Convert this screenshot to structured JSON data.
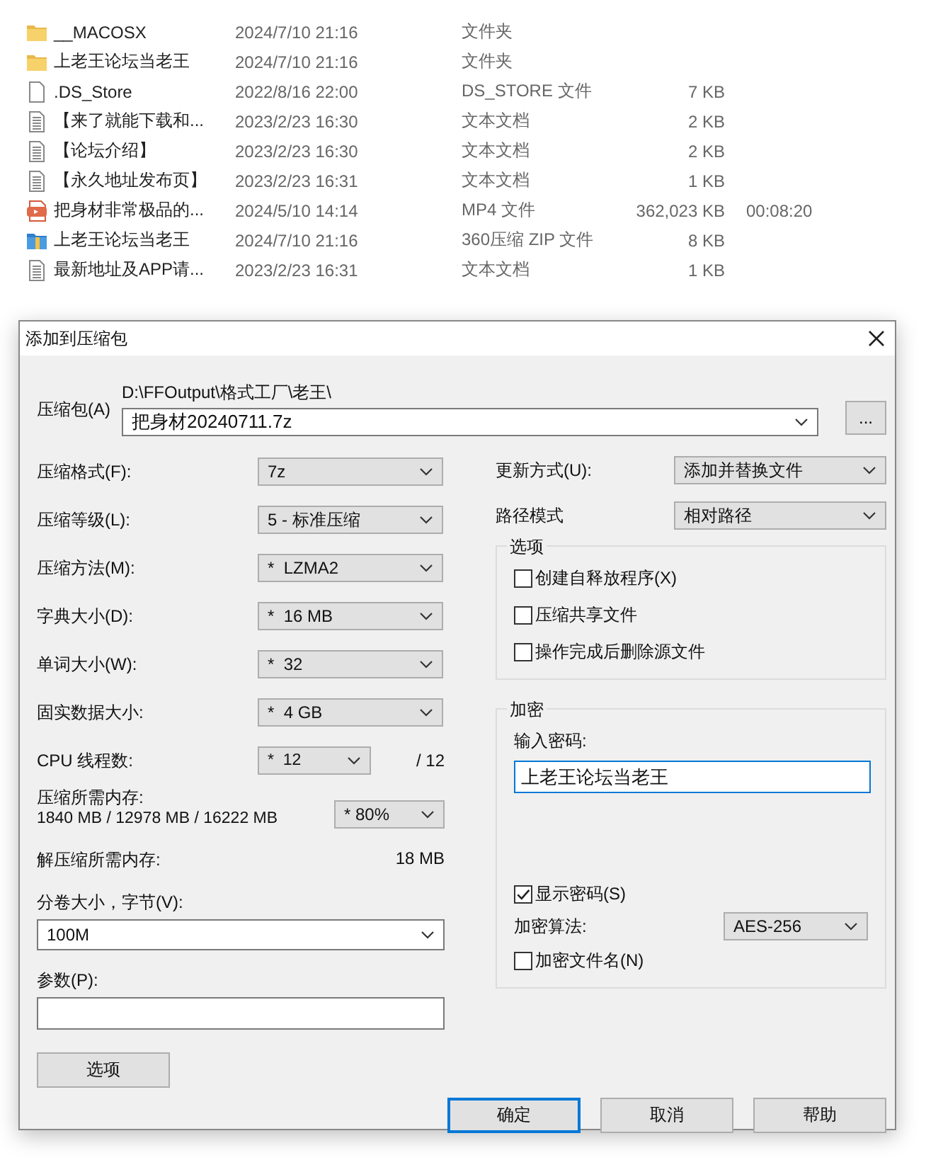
{
  "files": [
    {
      "kind": "folder",
      "name": "__MACOSX",
      "date": "2024/7/10 21:16",
      "type": "文件夹"
    },
    {
      "kind": "folder",
      "name": "上老王论坛当老王",
      "date": "2024/7/10 21:16",
      "type": "文件夹"
    },
    {
      "kind": "file",
      "name": ".DS_Store",
      "date": "2022/8/16 22:00",
      "type": "DS_STORE 文件",
      "size": "7 KB"
    },
    {
      "kind": "text",
      "name": "【来了就能下载和...",
      "date": "2023/2/23 16:30",
      "type": "文本文档",
      "size": "2 KB"
    },
    {
      "kind": "text",
      "name": "【论坛介绍】",
      "date": "2023/2/23 16:30",
      "type": "文本文档",
      "size": "2 KB"
    },
    {
      "kind": "text",
      "name": "【永久地址发布页】",
      "date": "2023/2/23 16:31",
      "type": "文本文档",
      "size": "1 KB"
    },
    {
      "kind": "video",
      "name": "把身材非常极品的...",
      "date": "2024/5/10 14:14",
      "type": "MP4 文件",
      "size": "362,023 KB",
      "length": "00:08:20"
    },
    {
      "kind": "archive",
      "name": "上老王论坛当老王",
      "date": "2024/7/10 21:16",
      "type": "360压缩 ZIP 文件",
      "size": "8 KB"
    },
    {
      "kind": "text",
      "name": "最新地址及APP请...",
      "date": "2023/2/23 16:31",
      "type": "文本文档",
      "size": "1 KB"
    }
  ],
  "dialog": {
    "title": "添加到压缩包",
    "archive": {
      "label": "压缩包(A)",
      "path": "D:\\FFOutput\\格式工厂\\老王\\",
      "value": "把身材20240711.7z",
      "browse": "..."
    },
    "settings": [
      {
        "label": "压缩格式(F):",
        "value": "7z"
      },
      {
        "label": "压缩等级(L):",
        "value": "5 - 标准压缩"
      },
      {
        "label": "压缩方法(M):",
        "value": "*  LZMA2"
      },
      {
        "label": "字典大小(D):",
        "value": "*  16 MB"
      },
      {
        "label": "单词大小(W):",
        "value": "*  32"
      },
      {
        "label": "固实数据大小:",
        "value": "*  4 GB"
      }
    ],
    "threads": {
      "label": "CPU 线程数:",
      "value": "*  12",
      "total": "/ 12"
    },
    "memory": {
      "label": "压缩所需内存:",
      "detail": "1840 MB / 12978 MB / 16222 MB",
      "value": "* 80%"
    },
    "decompress": {
      "label": "解压缩所需内存:",
      "value": "18 MB"
    },
    "volume": {
      "label": "分卷大小，字节(V):",
      "value": "100M"
    },
    "params": {
      "label": "参数(P):"
    },
    "options_button": "选项",
    "update": {
      "label": "更新方式(U):",
      "value": "添加并替换文件"
    },
    "path_mode": {
      "label": "路径模式",
      "value": "相对路径"
    },
    "options": {
      "title": "选项",
      "items": [
        {
          "label": "创建自释放程序(X)",
          "checked": false
        },
        {
          "label": "压缩共享文件",
          "checked": false
        },
        {
          "label": "操作完成后删除源文件",
          "checked": false
        }
      ]
    },
    "encryption": {
      "title": "加密",
      "password_label": "输入密码:",
      "password": "上老王论坛当老王",
      "show_password": {
        "label": "显示密码(S)",
        "checked": true
      },
      "method_label": "加密算法:",
      "method": "AES-256",
      "encrypt_names": {
        "label": "加密文件名(N)",
        "checked": false
      }
    },
    "buttons": [
      {
        "label": "确定",
        "default": true
      },
      {
        "label": "取消",
        "default": false
      },
      {
        "label": "帮助",
        "default": false
      }
    ]
  }
}
